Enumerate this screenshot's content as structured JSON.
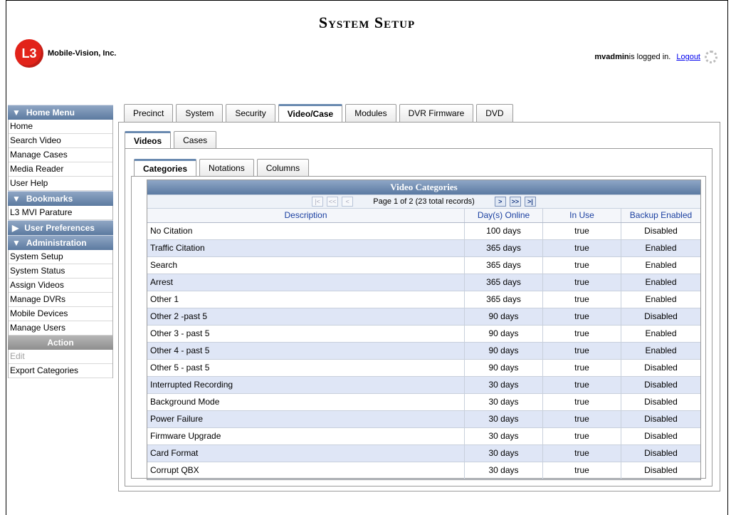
{
  "header": {
    "title": "System Setup",
    "company": "Mobile-Vision, Inc.",
    "logo_mark": "L3",
    "user": "mvadmin",
    "logged_in_text": " is logged in.",
    "logout_label": "Logout"
  },
  "sidebar": {
    "home_menu_title": "Home Menu",
    "home_items": [
      "Home",
      "Search Video",
      "Manage Cases",
      "Media Reader",
      "User Help"
    ],
    "bookmarks_title": "Bookmarks",
    "bookmark_items": [
      "L3 MVI Parature"
    ],
    "user_prefs_title": "User Preferences",
    "admin_title": "Administration",
    "admin_items": [
      "System Setup",
      "System Status",
      "Assign Videos",
      "Manage DVRs",
      "Mobile Devices",
      "Manage Users"
    ],
    "action_title": "Action",
    "action_items": [
      "Edit",
      "Export Categories"
    ]
  },
  "tabs": {
    "outer": [
      "Precinct",
      "System",
      "Security",
      "Video/Case",
      "Modules",
      "DVR Firmware",
      "DVD"
    ],
    "outer_active": "Video/Case",
    "mid": [
      "Videos",
      "Cases"
    ],
    "mid_active": "Videos",
    "inner": [
      "Categories",
      "Notations",
      "Columns"
    ],
    "inner_active": "Categories"
  },
  "grid": {
    "title": "Video Categories",
    "pager_text": "Page 1 of 2 (23 total records)",
    "columns": [
      "Description",
      "Day(s) Online",
      "In Use",
      "Backup Enabled"
    ],
    "rows": [
      [
        "No Citation",
        "100 days",
        "true",
        "Disabled"
      ],
      [
        "Traffic Citation",
        "365 days",
        "true",
        "Enabled"
      ],
      [
        "Search",
        "365 days",
        "true",
        "Enabled"
      ],
      [
        "Arrest",
        "365 days",
        "true",
        "Enabled"
      ],
      [
        "Other 1",
        "365 days",
        "true",
        "Enabled"
      ],
      [
        "Other 2 -past 5",
        "90 days",
        "true",
        "Disabled"
      ],
      [
        "Other 3 - past 5",
        "90 days",
        "true",
        "Enabled"
      ],
      [
        "Other 4 - past 5",
        "90 days",
        "true",
        "Enabled"
      ],
      [
        "Other 5 - past 5",
        "90 days",
        "true",
        "Disabled"
      ],
      [
        "Interrupted Recording",
        "30 days",
        "true",
        "Disabled"
      ],
      [
        "Background Mode",
        "30 days",
        "true",
        "Disabled"
      ],
      [
        "Power Failure",
        "30 days",
        "true",
        "Disabled"
      ],
      [
        "Firmware Upgrade",
        "30 days",
        "true",
        "Disabled"
      ],
      [
        "Card Format",
        "30 days",
        "true",
        "Disabled"
      ],
      [
        "Corrupt QBX",
        "30 days",
        "true",
        "Disabled"
      ]
    ]
  },
  "colors": {
    "header_blue": "#5c7aa0",
    "row_alt": "#dfe6f6",
    "link": "#0000ee"
  }
}
